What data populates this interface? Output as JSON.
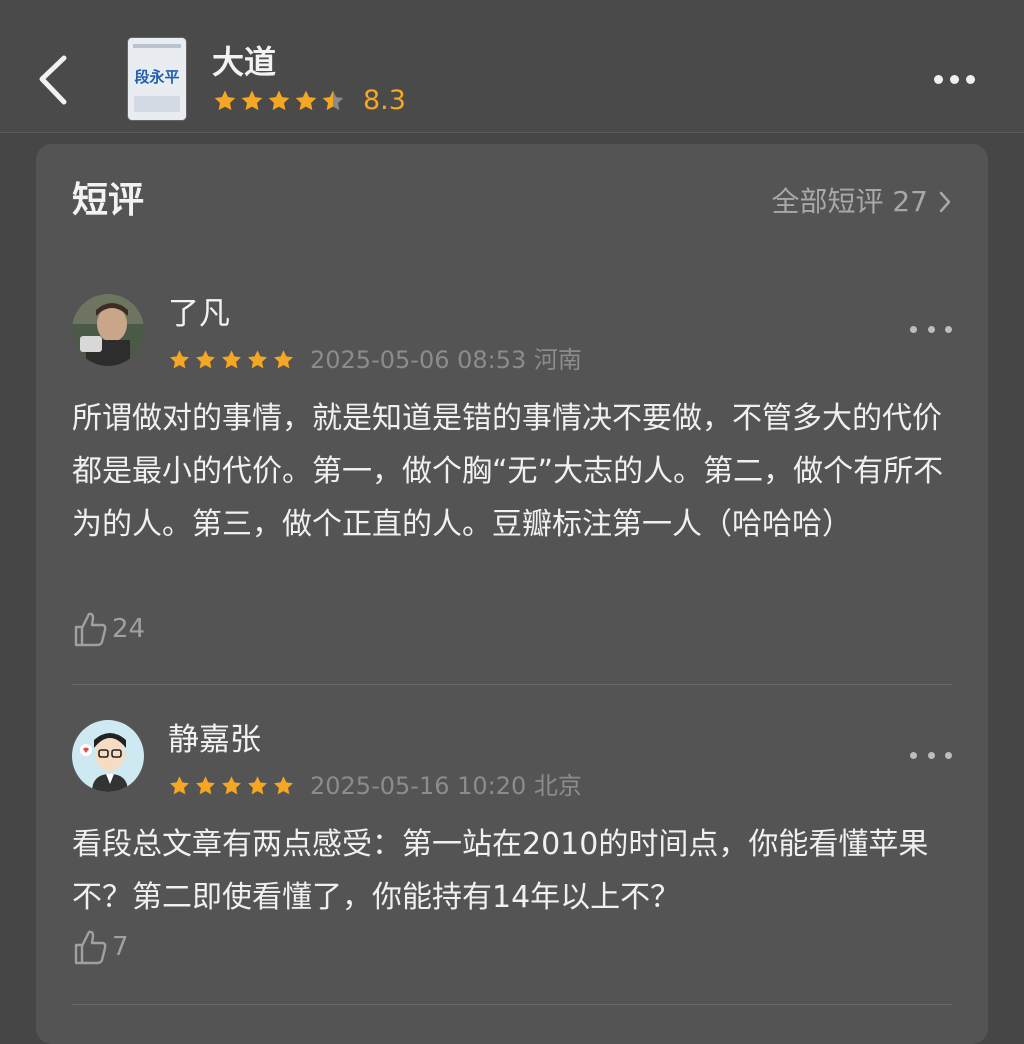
{
  "header": {
    "back_icon": "chevron-left-icon",
    "cover_text": "段永平",
    "book_title": "大道",
    "rating_stars": 4.5,
    "rating_score": "8.3",
    "more_icon": "more-horizontal-icon"
  },
  "section": {
    "title": "短评",
    "all_link": "全部短评 27"
  },
  "reviews": [
    {
      "username": "了凡",
      "stars": 5,
      "time": "2025-05-06 08:53 河南",
      "content": "所谓做对的事情，就是知道是错的事情决不要做，不管多大的代价都是最小的代价。第一，做个胸“无”大志的人。第二，做个有所不为的人。第三，做个正直的人。豆瓣标注第一人（哈哈哈）",
      "likes": "24"
    },
    {
      "username": "静嘉张",
      "stars": 5,
      "time": "2025-05-16 10:20 北京",
      "content": "看段总文章有两点感受：第一站在2010的时间点，你能看懂苹果不？第二即使看懂了，你能持有14年以上不？",
      "likes": "7"
    }
  ],
  "colors": {
    "background": "#464646",
    "card": "#545454",
    "star": "#f5a623",
    "muted_text": "#8c8c8c"
  }
}
